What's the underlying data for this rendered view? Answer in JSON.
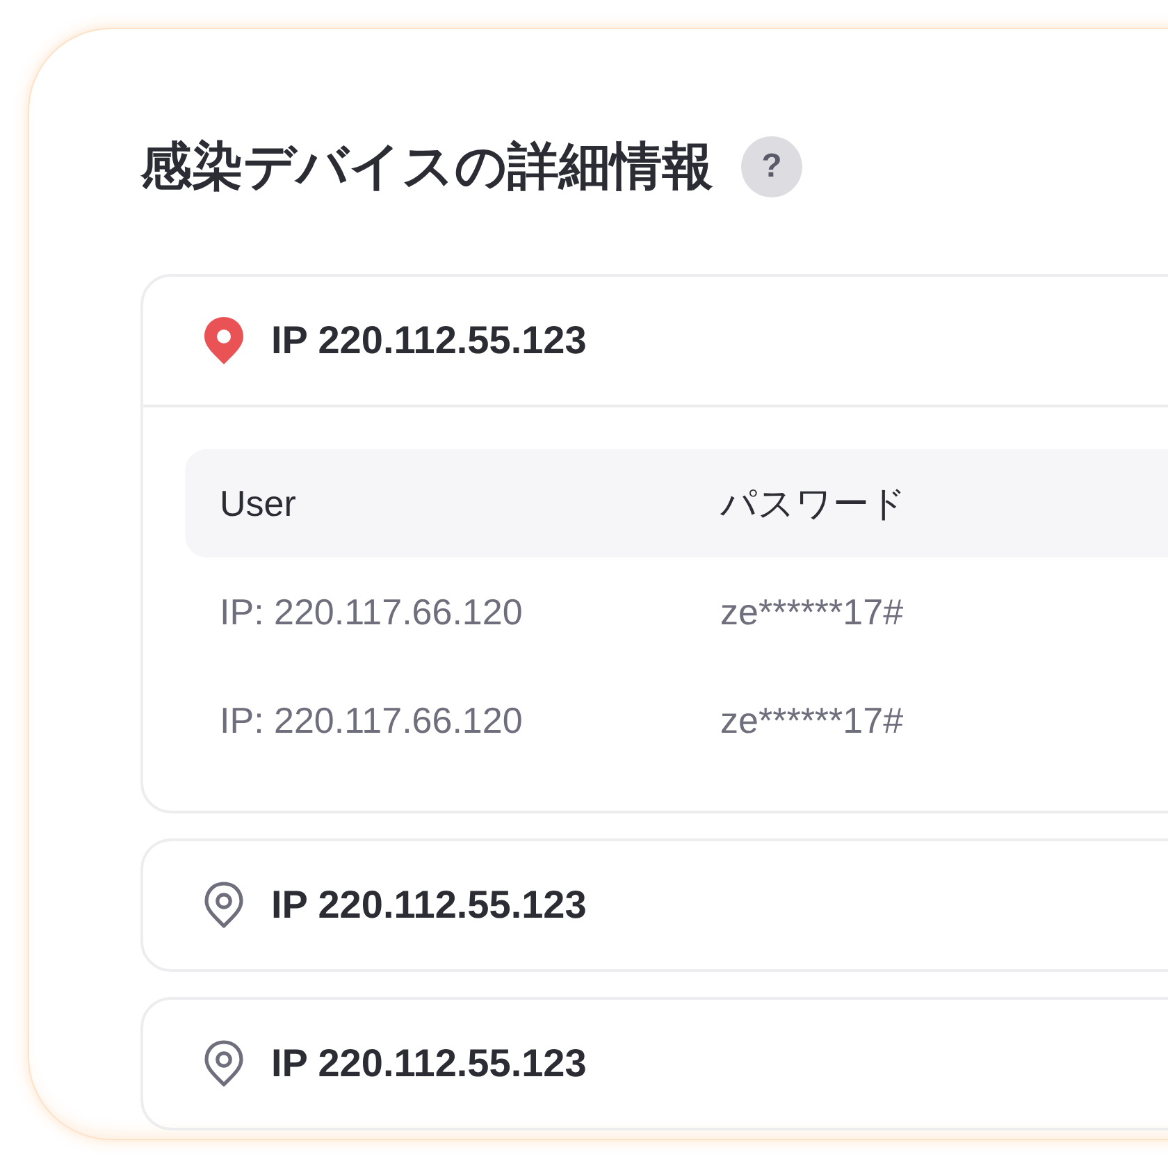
{
  "title": "感染デバイスの詳細情報",
  "help_icon": "?",
  "devices": [
    {
      "label": "IP 220.112.55.123",
      "expanded": true,
      "columns": [
        "User",
        "パスワード"
      ],
      "rows": [
        [
          "IP: 220.117.66.120",
          "ze******17#"
        ],
        [
          "IP: 220.117.66.120",
          "ze******17#"
        ]
      ]
    },
    {
      "label": "IP 220.112.55.123",
      "expanded": false
    },
    {
      "label": "IP 220.112.55.123",
      "expanded": false
    }
  ]
}
